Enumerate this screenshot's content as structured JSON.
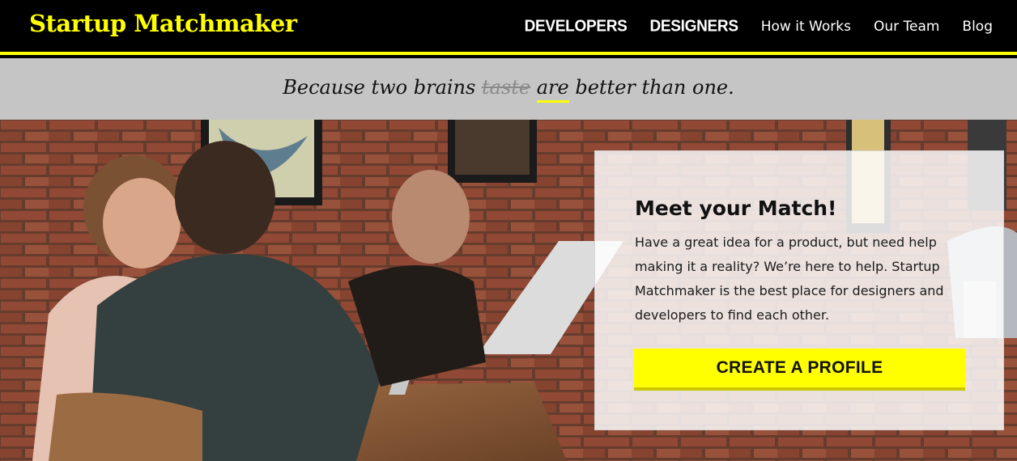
{
  "header": {
    "logo": "Startup Matchmaker",
    "nav": [
      {
        "label": "DEVELOPERS"
      },
      {
        "label": "DESIGNERS"
      },
      {
        "label": "How it Works"
      },
      {
        "label": "Our Team"
      },
      {
        "label": "Blog"
      }
    ]
  },
  "tagline": {
    "before": "Because two brains ",
    "struck": "taste",
    "underlined": "are",
    "after": " better than one."
  },
  "hero": {
    "card": {
      "title": "Meet your Match!",
      "body": "Have a great idea for a product, but need help making it a reality? We’re here to help. Startup Matchmaker is the best place for designers and developers to find each other.",
      "cta_label": "CREATE A PROFILE"
    },
    "photo_icon": "cafe-photo"
  },
  "colors": {
    "accent": "#ffff00",
    "header_bg": "#000000",
    "tagline_bg": "#c5c5c5"
  }
}
